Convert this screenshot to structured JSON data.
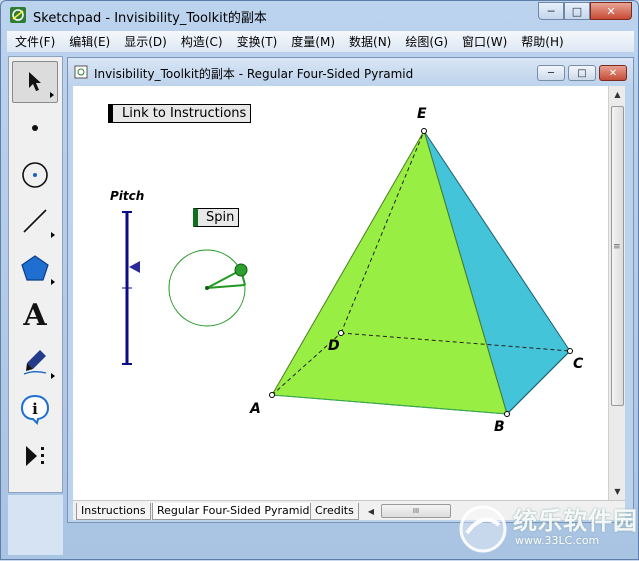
{
  "window": {
    "title": "Sketchpad  - Invisibility_Toolkit的副本",
    "min_glyph": "─",
    "max_glyph": "□",
    "close_glyph": "✕"
  },
  "menu": [
    {
      "label": "文件(F)"
    },
    {
      "label": "编辑(E)"
    },
    {
      "label": "显示(D)"
    },
    {
      "label": "构造(C)"
    },
    {
      "label": "变换(T)"
    },
    {
      "label": "度量(M)"
    },
    {
      "label": "数据(N)"
    },
    {
      "label": "绘图(G)"
    },
    {
      "label": "窗口(W)"
    },
    {
      "label": "帮助(H)"
    }
  ],
  "toolbox": {
    "tools": [
      {
        "name": "arrow-tool-icon"
      },
      {
        "name": "point-tool-icon"
      },
      {
        "name": "compass-tool-icon"
      },
      {
        "name": "straightedge-tool-icon"
      },
      {
        "name": "polygon-tool-icon"
      },
      {
        "name": "text-tool-icon"
      },
      {
        "name": "marker-tool-icon"
      },
      {
        "name": "information-tool-icon"
      },
      {
        "name": "custom-tool-icon"
      }
    ],
    "text_tool_glyph": "A",
    "info_glyph": "i"
  },
  "document": {
    "title": "Invisibility_Toolkit的副本 - Regular Four-Sided Pyramid",
    "min_glyph": "─",
    "max_glyph": "□",
    "close_glyph": "✕",
    "link_button": "Link to Instructions",
    "spin_button": "Spin",
    "pitch_label": "Pitch",
    "vertices": {
      "A": "A",
      "B": "B",
      "C": "C",
      "D": "D",
      "E": "E"
    },
    "face_colors": {
      "front": "#99ee44",
      "side": "#44c4d8",
      "slider": "#0a0a8a",
      "spin": "#229922"
    },
    "tabs": [
      {
        "label": "Instructions",
        "active": false
      },
      {
        "label": "Regular Four-Sided Pyramid",
        "active": true
      },
      {
        "label": "Credits",
        "active": false
      }
    ],
    "hscroll_thumb": "III",
    "vscroll_grip": "≡"
  },
  "watermark": {
    "text": "统乐软件园",
    "sub": "www.33LC.com"
  }
}
